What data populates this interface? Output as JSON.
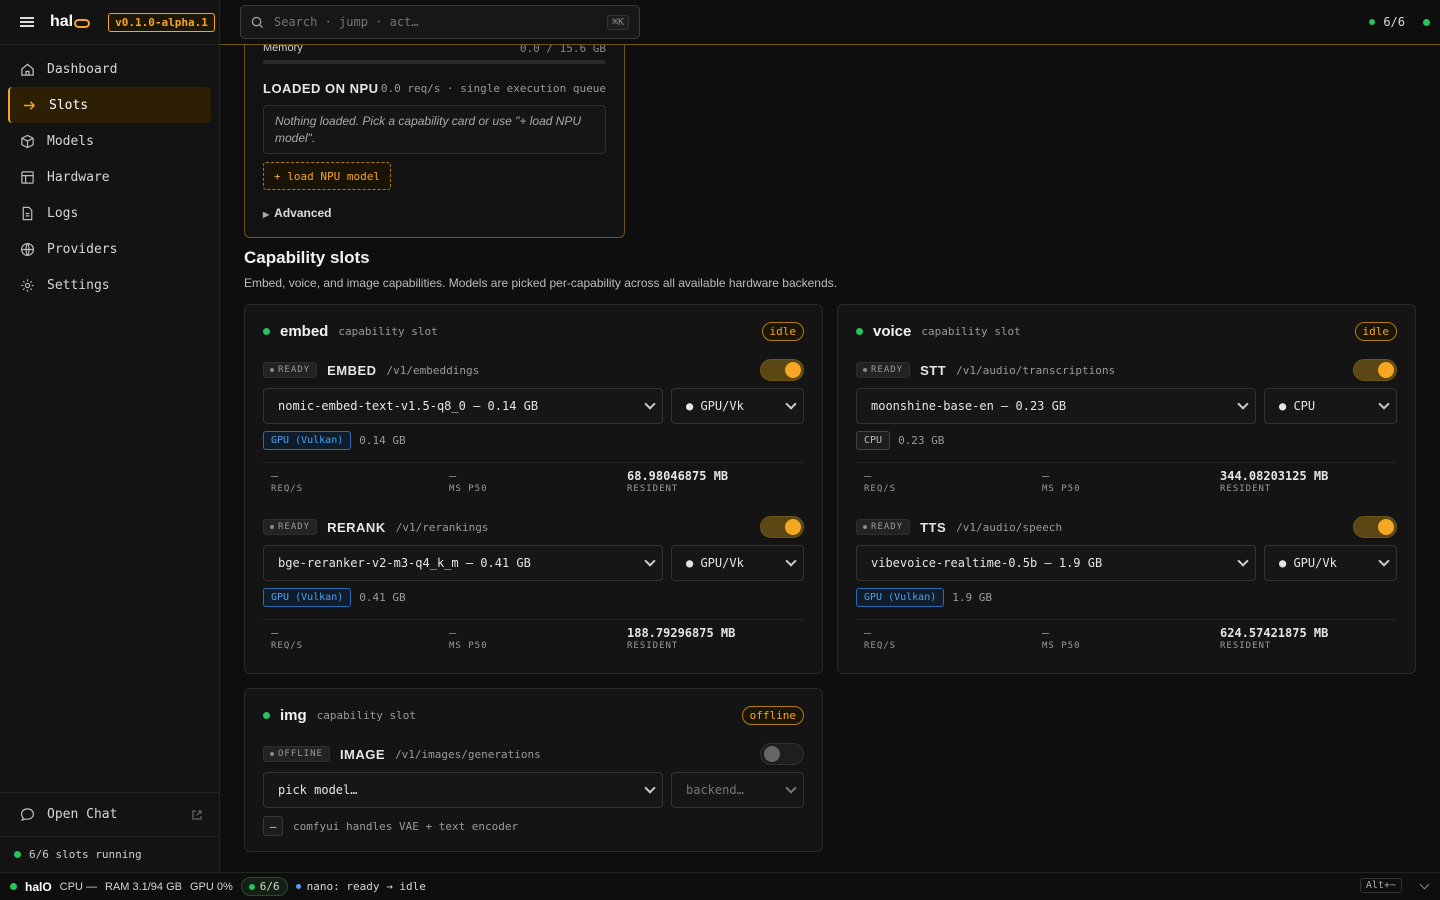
{
  "app": {
    "name": "hal",
    "version": "v0.1.0-alpha.1"
  },
  "search": {
    "placeholder": "Search · jump · act…",
    "shortcut": "⌘K"
  },
  "top_right": {
    "slots": "6/6"
  },
  "nav": [
    {
      "label": "Dashboard",
      "icon": "home-icon"
    },
    {
      "label": "Slots",
      "icon": "arrow-right-icon",
      "active": true
    },
    {
      "label": "Models",
      "icon": "cube-icon"
    },
    {
      "label": "Hardware",
      "icon": "grid-icon"
    },
    {
      "label": "Logs",
      "icon": "document-icon"
    },
    {
      "label": "Providers",
      "icon": "globe-icon"
    },
    {
      "label": "Settings",
      "icon": "gear-icon"
    }
  ],
  "sidebar_footer": {
    "open_chat": "Open Chat",
    "slots_running": "6/6 slots running"
  },
  "npu": {
    "memory_label": "Memory",
    "memory_value": "0.0 / 15.6 GB",
    "memory_fraction": 0,
    "title": "LOADED ON NPU",
    "stats": "0.0 req/s · single execution queue",
    "empty_text": "Nothing loaded. Pick a capability card or use \"+ load NPU model\".",
    "load_button": "+ load NPU model",
    "advanced": "Advanced"
  },
  "section": {
    "title": "Capability slots",
    "description": "Embed, voice, and image capabilities. Models are picked per-capability across all available hardware backends."
  },
  "cards": {
    "embed": {
      "name": "embed",
      "sub": "capability slot",
      "status": "idle",
      "items": [
        {
          "state": "READY",
          "cap": "EMBED",
          "endpoint": "/v1/embeddings",
          "enabled": true,
          "model": "nomic-embed-text-v1.5-q8_0 — 0.14 GB",
          "backend": "● GPU/Vk",
          "tag": "GPU (Vulkan)",
          "size": "0.14 GB",
          "req": "—",
          "req_label": "REQ/S",
          "ms": "—",
          "ms_label": "MS P50",
          "resident": "68.98046875 MB",
          "resident_label": "RESIDENT"
        },
        {
          "state": "READY",
          "cap": "RERANK",
          "endpoint": "/v1/rerankings",
          "enabled": true,
          "model": "bge-reranker-v2-m3-q4_k_m — 0.41 GB",
          "backend": "● GPU/Vk",
          "tag": "GPU (Vulkan)",
          "size": "0.41 GB",
          "req": "—",
          "req_label": "REQ/S",
          "ms": "—",
          "ms_label": "MS P50",
          "resident": "188.79296875 MB",
          "resident_label": "RESIDENT"
        }
      ]
    },
    "voice": {
      "name": "voice",
      "sub": "capability slot",
      "status": "idle",
      "items": [
        {
          "state": "READY",
          "cap": "STT",
          "endpoint": "/v1/audio/transcriptions",
          "enabled": true,
          "model": "moonshine-base-en — 0.23 GB",
          "backend": "● CPU",
          "tag": "CPU",
          "size": "0.23 GB",
          "req": "—",
          "req_label": "REQ/S",
          "ms": "—",
          "ms_label": "MS P50",
          "resident": "344.08203125 MB",
          "resident_label": "RESIDENT"
        },
        {
          "state": "READY",
          "cap": "TTS",
          "endpoint": "/v1/audio/speech",
          "enabled": true,
          "model": "vibevoice-realtime-0.5b — 1.9 GB",
          "backend": "● GPU/Vk",
          "tag": "GPU (Vulkan)",
          "size": "1.9 GB",
          "req": "—",
          "req_label": "REQ/S",
          "ms": "—",
          "ms_label": "MS P50",
          "resident": "624.57421875 MB",
          "resident_label": "RESIDENT"
        }
      ]
    },
    "img": {
      "name": "img",
      "sub": "capability slot",
      "status": "offline",
      "items": [
        {
          "state": "OFFLINE",
          "cap": "IMAGE",
          "endpoint": "/v1/images/generations",
          "enabled": false,
          "model": "pick model…",
          "backend": "backend…",
          "note_icon": "—",
          "note": "comfyui handles VAE + text encoder"
        }
      ]
    }
  },
  "statusbar": {
    "name": "halO",
    "cpu": "CPU —",
    "ram": "RAM 3.1/94 GB",
    "gpu": "GPU 0%",
    "slots": "6/6",
    "nano": "nano: ready → idle",
    "shortcut": "Alt+~"
  },
  "colors": {
    "accent": "#f5a623",
    "ok": "#22c55e",
    "vulkan": "#4ea3f0",
    "bg": "#0e0e0e"
  }
}
